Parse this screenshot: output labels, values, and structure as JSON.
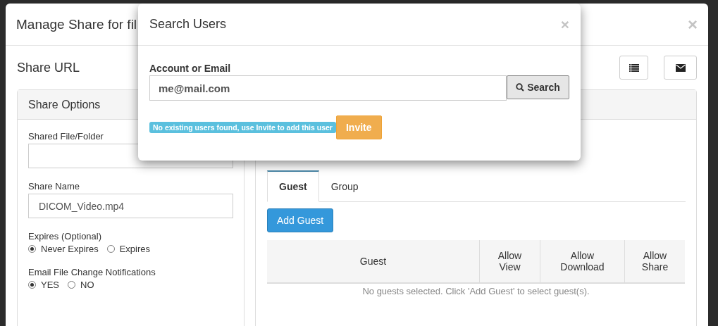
{
  "window": {
    "title": "Manage Share for fil",
    "close": "×"
  },
  "share_url": {
    "label": "Share URL"
  },
  "share_options": {
    "title": "Share Options",
    "fields": [
      {
        "label": "Shared File/Folder"
      },
      {
        "label": "Share Name",
        "value": "DICOM_Video.mp4"
      }
    ],
    "radio_groups": [
      {
        "label": "Expires (Optional)",
        "options": [
          {
            "label": "Never Expires",
            "selected": true
          },
          {
            "label": "Expires",
            "selected": false
          }
        ]
      },
      {
        "label": "Email File Change Notifications",
        "options": [
          {
            "label": "YES",
            "selected": true
          },
          {
            "label": "NO",
            "selected": false
          }
        ]
      }
    ]
  },
  "guests": {
    "tabs": [
      {
        "label": "Guest",
        "selected": true
      },
      {
        "label": "Group",
        "selected": false
      }
    ],
    "add_button": "Add Guest",
    "columns": [
      "Guest",
      "Allow View",
      "Allow Download",
      "Allow Share"
    ],
    "empty_message": "No guests selected. Click 'Add Guest' to select guest(s)."
  },
  "search_dialog": {
    "title": "Search Users",
    "close": "×",
    "field_label": "Account or Email",
    "value": "me@mail.com",
    "search_button": "Search",
    "notice": "No existing users found, use Invite to add this user",
    "invite_button": "Invite"
  }
}
